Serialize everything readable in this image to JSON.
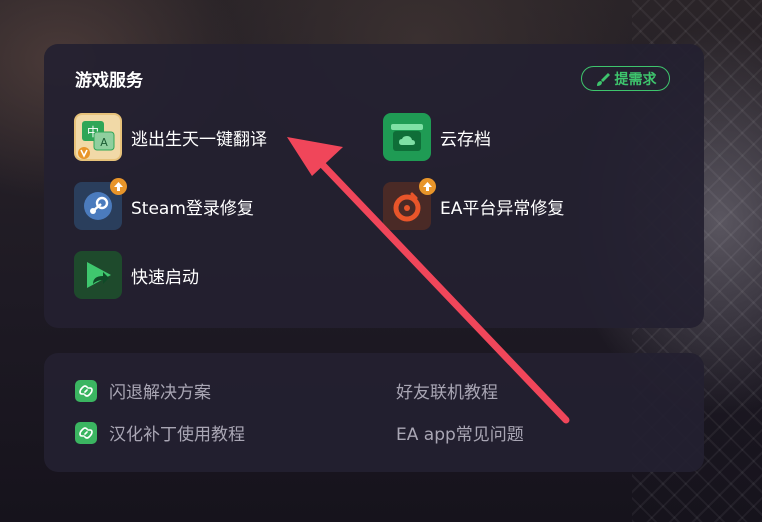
{
  "services": {
    "title": "游戏服务",
    "request_label": "提需求",
    "items": [
      {
        "label": "逃出生天一键翻译",
        "icon": "translate-icon"
      },
      {
        "label": "云存档",
        "icon": "cloud-save-icon"
      },
      {
        "label": "Steam登录修复",
        "icon": "steam-icon"
      },
      {
        "label": "EA平台异常修复",
        "icon": "ea-origin-icon"
      },
      {
        "label": "快速启动",
        "icon": "quick-launch-icon"
      }
    ],
    "translate_icon_text": {
      "zh": "中",
      "en": "A"
    }
  },
  "links": {
    "items": [
      {
        "label": "闪退解决方案"
      },
      {
        "label": "好友联机教程"
      },
      {
        "label": "汉化补丁使用教程"
      },
      {
        "label": "EA app常见问题"
      }
    ]
  },
  "colors": {
    "accent_green": "#3ec46d",
    "badge_orange": "#e8952a",
    "annotation_arrow": "#f0465a"
  }
}
